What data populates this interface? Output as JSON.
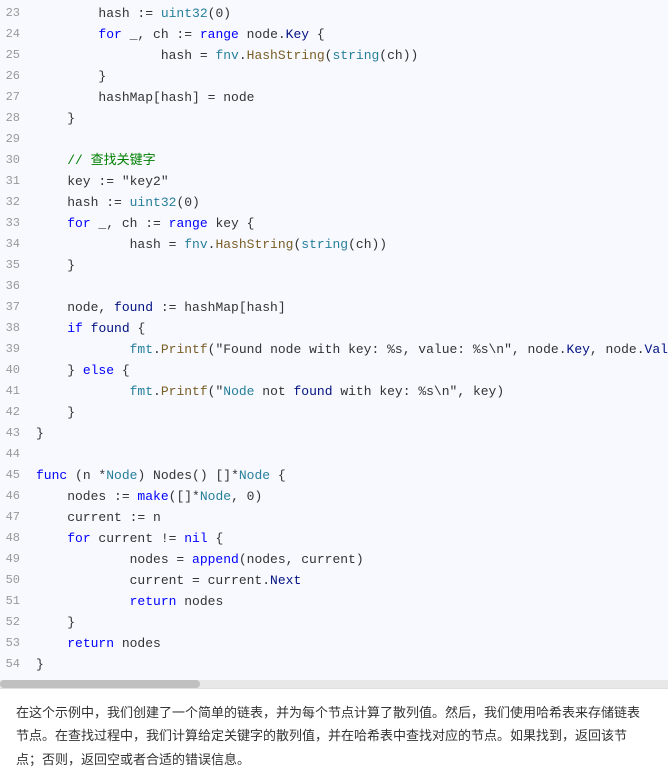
{
  "code": {
    "lines": [
      {
        "num": 23,
        "tokens": [
          {
            "t": "        hash := uint32(0)",
            "c": ""
          }
        ]
      },
      {
        "num": 24,
        "tokens": [
          {
            "t": "        for _, ch := range node.Key {",
            "c": ""
          }
        ]
      },
      {
        "num": 25,
        "tokens": [
          {
            "t": "                hash = fnv.HashString(string(ch))",
            "c": ""
          }
        ]
      },
      {
        "num": 26,
        "tokens": [
          {
            "t": "        }",
            "c": ""
          }
        ]
      },
      {
        "num": 27,
        "tokens": [
          {
            "t": "        hashMap[hash] = node",
            "c": ""
          }
        ]
      },
      {
        "num": 28,
        "tokens": [
          {
            "t": "    }",
            "c": ""
          }
        ]
      },
      {
        "num": 29,
        "tokens": [
          {
            "t": "",
            "c": ""
          }
        ]
      },
      {
        "num": 30,
        "tokens": [
          {
            "t": "    // 查找关键字",
            "c": "cmt"
          }
        ]
      },
      {
        "num": 31,
        "tokens": [
          {
            "t": "    key := \"key2\"",
            "c": ""
          }
        ]
      },
      {
        "num": 32,
        "tokens": [
          {
            "t": "    hash := uint32(0)",
            "c": ""
          }
        ]
      },
      {
        "num": 33,
        "tokens": [
          {
            "t": "    for _, ch := range key {",
            "c": ""
          }
        ]
      },
      {
        "num": 34,
        "tokens": [
          {
            "t": "            hash = fnv.HashString(string(ch))",
            "c": ""
          }
        ]
      },
      {
        "num": 35,
        "tokens": [
          {
            "t": "    }",
            "c": ""
          }
        ]
      },
      {
        "num": 36,
        "tokens": [
          {
            "t": "",
            "c": ""
          }
        ]
      },
      {
        "num": 37,
        "tokens": [
          {
            "t": "    node, found := hashMap[hash]",
            "c": ""
          }
        ]
      },
      {
        "num": 38,
        "tokens": [
          {
            "t": "    if found {",
            "c": ""
          }
        ]
      },
      {
        "num": 39,
        "tokens": [
          {
            "t": "            fmt.Printf(\"Found node with key: %s, value: %s\\n\", node.Key, node.Val",
            "c": ""
          }
        ]
      },
      {
        "num": 40,
        "tokens": [
          {
            "t": "    } else {",
            "c": ""
          }
        ]
      },
      {
        "num": 41,
        "tokens": [
          {
            "t": "            fmt.Printf(\"Node not found with key: %s\\n\", key)",
            "c": ""
          }
        ]
      },
      {
        "num": 42,
        "tokens": [
          {
            "t": "    }",
            "c": ""
          }
        ]
      },
      {
        "num": 43,
        "tokens": [
          {
            "t": "}",
            "c": ""
          }
        ]
      },
      {
        "num": 44,
        "tokens": [
          {
            "t": "",
            "c": ""
          }
        ]
      },
      {
        "num": 45,
        "tokens": [
          {
            "t": "func (n *Node) Nodes() []*Node {",
            "c": ""
          }
        ]
      },
      {
        "num": 46,
        "tokens": [
          {
            "t": "    nodes := make([]*Node, 0)",
            "c": ""
          }
        ]
      },
      {
        "num": 47,
        "tokens": [
          {
            "t": "    current := n",
            "c": ""
          }
        ]
      },
      {
        "num": 48,
        "tokens": [
          {
            "t": "    for current != nil {",
            "c": ""
          }
        ]
      },
      {
        "num": 49,
        "tokens": [
          {
            "t": "            nodes = append(nodes, current)",
            "c": ""
          }
        ]
      },
      {
        "num": 50,
        "tokens": [
          {
            "t": "            current = current.Next",
            "c": ""
          }
        ]
      },
      {
        "num": 51,
        "tokens": [
          {
            "t": "            return nodes",
            "c": ""
          }
        ]
      },
      {
        "num": 52,
        "tokens": [
          {
            "t": "    }",
            "c": ""
          }
        ]
      },
      {
        "num": 53,
        "tokens": [
          {
            "t": "    return nodes",
            "c": ""
          }
        ]
      },
      {
        "num": 54,
        "tokens": [
          {
            "t": "}",
            "c": ""
          }
        ]
      }
    ]
  },
  "description": "在这个示例中，我们创建了一个简单的链表，并为每个节点计算了散列值。然后，我们使用哈希表来存储链表节点。在查找过程中，我们计算给定关键字的散列值，并在哈希表中查找对应的节点。如果找到，返回该节点；否则，返回空或者合适的错误信息。"
}
